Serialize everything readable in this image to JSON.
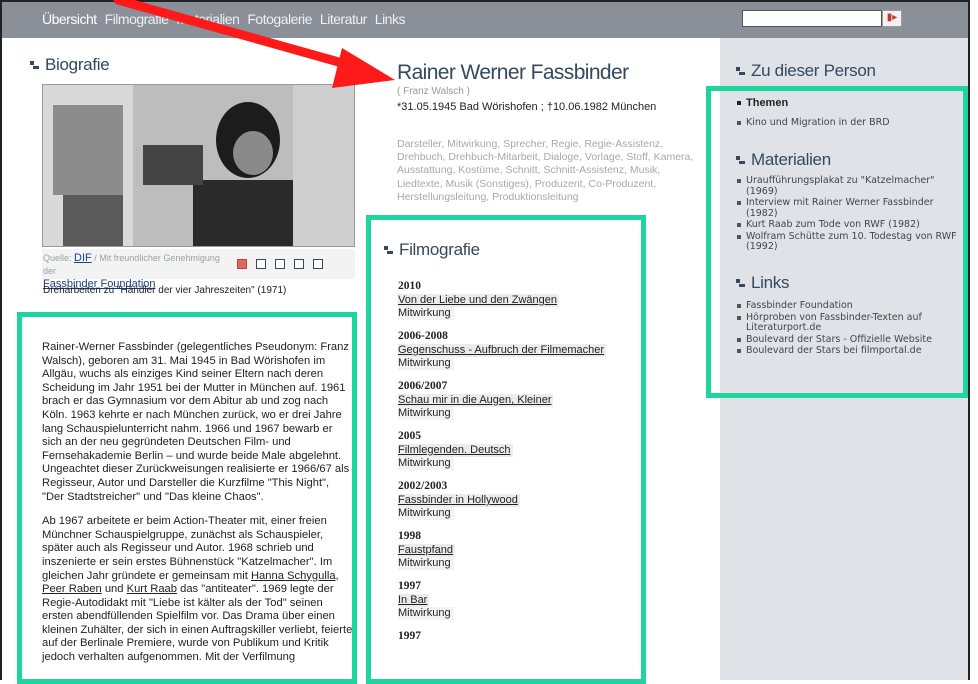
{
  "nav": {
    "items": [
      "Übersicht",
      "Filmografie",
      "Materialien",
      "Fotogalerie",
      "Literatur",
      "Links"
    ],
    "search_button": "▮▸"
  },
  "biografie": {
    "heading": "Biografie",
    "source_prefix": "Quelle:",
    "source_link": "DIF",
    "source_suffix": "/ Mit freundlicher Genehmigung der",
    "foundation_link": "Fassbinder Foundation",
    "photo_caption": "Dreharbeiten zu \"Händler der vier Jahreszeiten\" (1971)",
    "paragraph1": "Rainer-Werner Fassbinder (gelegentliches Pseudonym: Franz Walsch), geboren am 31. Mai 1945 in Bad Wörishofen im Allgäu, wuchs als einziges Kind seiner Eltern nach deren Scheidung im Jahr 1951 bei der Mutter in München auf. 1961 brach er das Gymnasium vor dem Abitur ab und zog nach Köln. 1963 kehrte er nach München zurück, wo er drei Jahre lang Schauspielunterricht nahm. 1966 und 1967 bewarb er sich an der neu gegründeten Deutschen Film- und Fernsehakademie Berlin – und wurde beide Male abgelehnt. Ungeachtet dieser Zurückweisungen realisierte er 1966/67 als Regisseur, Autor und Darsteller die Kurzfilme \"This Night\", \"Der Stadtstreicher\" und \"Das kleine Chaos\".",
    "paragraph2_a": "Ab 1967 arbeitete er beim Action-Theater mit, einer freien Münchner Schauspielgruppe, zunächst als Schauspieler, später auch als Regisseur und Autor. 1968 schrieb und inszenierte er sein erstes Bühnenstück \"Katzelmacher\". Im gleichen Jahr gründete er gemeinsam mit",
    "link_schygulla": "Hanna Schygulla",
    "link_raben": "Peer Raben",
    "paragraph2_and": "und",
    "link_raab": "Kurt Raab",
    "paragraph2_b": "das \"antiteater\". 1969 legte der Regie-Autodidakt mit \"Liebe ist kälter als der Tod\" seinen ersten abendfüllenden Spielfilm vor. Das Drama über einen kleinen Zuhälter, der sich in einen Auftragskiller verliebt, feierte auf der Berlinale Premiere, wurde von Publikum und Kritik jedoch verhalten aufgenommen. Mit der Verfilmung"
  },
  "person": {
    "name": "Rainer Werner Fassbinder",
    "pseudonym": "( Franz Walsch )",
    "dates": "*31.05.1945 Bad Wörishofen ; †10.06.1982 München",
    "roles": "Darsteller, Mitwirkung, Sprecher, Regie, Regie-Assistenz, Drehbuch, Drehbuch-Mitarbeit, Dialoge, Vorlage, Stoff, Kamera, Ausstattung, Kostüme, Schnitt, Schnitt-Assistenz, Musik, Liedtexte, Musik (Sonstiges), Produzent, Co-Produzent, Herstellungsleitung, Produktionsleitung"
  },
  "filmografie": {
    "heading": "Filmografie",
    "items": [
      {
        "year": "2010",
        "title": "Von der Liebe und den Zwängen",
        "role": "Mitwirkung"
      },
      {
        "year": "2006-2008",
        "title": "Gegenschuss - Aufbruch der Filmemacher",
        "role": "Mitwirkung"
      },
      {
        "year": "2006/2007",
        "title": "Schau mir in die Augen, Kleiner",
        "role": "Mitwirkung"
      },
      {
        "year": "2005",
        "title": "Filmlegenden. Deutsch",
        "role": "Mitwirkung"
      },
      {
        "year": "2002/2003",
        "title": "Fassbinder in Hollywood",
        "role": "Mitwirkung"
      },
      {
        "year": "1998",
        "title": "Faustpfand",
        "role": "Mitwirkung"
      },
      {
        "year": "1997",
        "title": "In Bar",
        "role": "Mitwirkung"
      },
      {
        "year": "1997",
        "title": "",
        "role": ""
      }
    ]
  },
  "sidebar": {
    "heading_person": "Zu dieser Person",
    "themen_heading": "Themen",
    "themen": [
      "Kino und Migration in der BRD"
    ],
    "heading_materialien": "Materialien",
    "materialien": [
      "Uraufführungsplakat zu \"Katzelmacher\" (1969)",
      "Interview mit Rainer Werner Fassbinder (1982)",
      "Kurt Raab zum Tode von RWF (1982)",
      "Wolfram Schütte zum 10. Todestag von RWF (1992)"
    ],
    "heading_links": "Links",
    "links": [
      "Fassbinder Foundation",
      "Hörproben von Fassbinder-Texten auf Literaturport.de",
      "Boulevard der Stars - Offizielle Website",
      "Boulevard der Stars bei filmportal.de"
    ]
  },
  "colors": {
    "highlight": "#1ed5a0",
    "arrow": "#ff1a1a",
    "nav_bg": "#8a8f98",
    "sidebar_bg": "#dfe3e8",
    "heading": "#34495e"
  }
}
